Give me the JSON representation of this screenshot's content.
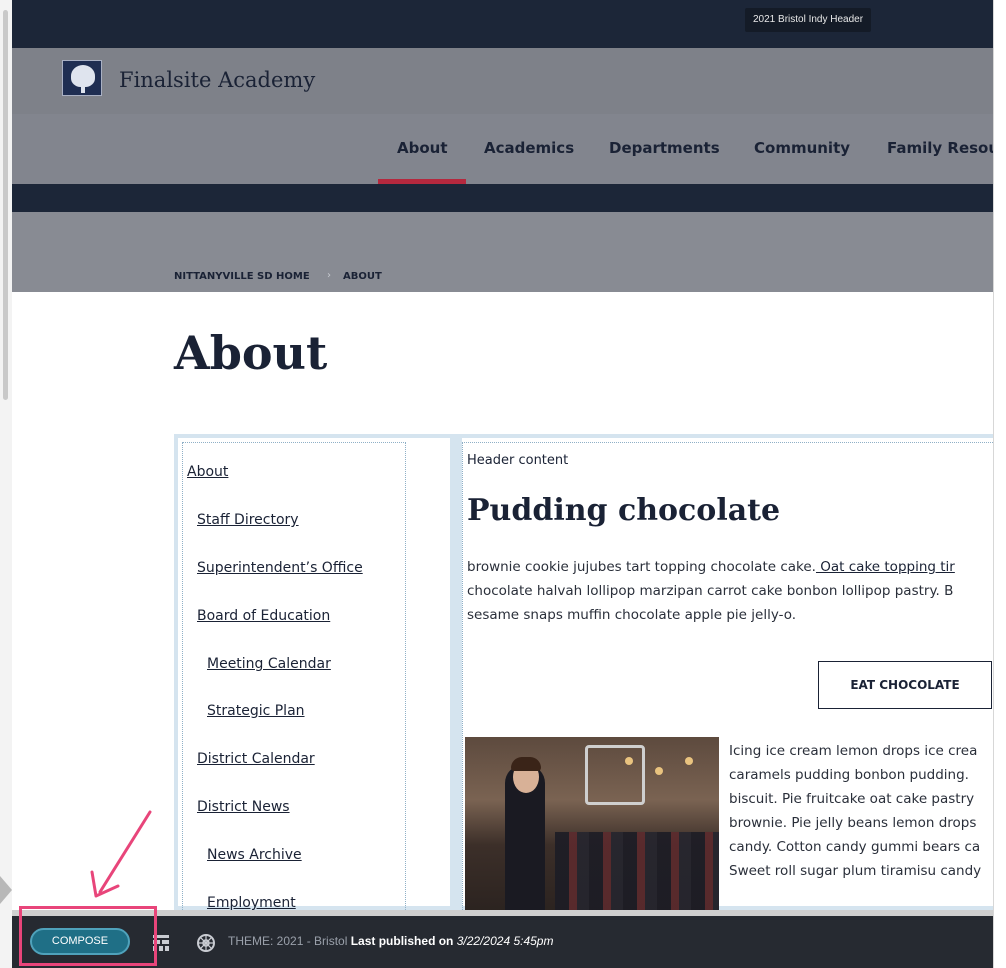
{
  "tooltip": "2021 Bristol Indy Header",
  "brand": {
    "name": "Finalsite Academy",
    "logo_icon": "tree-logo-icon"
  },
  "nav": {
    "items": [
      {
        "label": "About",
        "active": true
      },
      {
        "label": "Academics"
      },
      {
        "label": "Departments"
      },
      {
        "label": "Community"
      },
      {
        "label": "Family Resou"
      }
    ]
  },
  "breadcrumb": {
    "home": "NITTANYVILLE SD HOME",
    "separator": "›",
    "current": "ABOUT"
  },
  "page": {
    "title": "About"
  },
  "sidebar": {
    "items": [
      {
        "label": "About"
      },
      {
        "label": "Staff Directory"
      },
      {
        "label": "Superintendent’s Office"
      },
      {
        "label": "Board of Education"
      },
      {
        "label": "Meeting Calendar"
      },
      {
        "label": "Strategic Plan"
      },
      {
        "label": "District Calendar"
      },
      {
        "label": "District News"
      },
      {
        "label": "News Archive"
      },
      {
        "label": "Employment"
      }
    ]
  },
  "content": {
    "header_label": "Header content",
    "heading": "Pudding chocolate",
    "para_line1_a": "brownie cookie jujubes tart topping chocolate cake.",
    "para_line1_link": " Oat cake topping tir",
    "para_line2": "chocolate halvah lollipop marzipan carrot cake bonbon lollipop pastry. B",
    "para_line3": "sesame snaps muffin chocolate apple pie jelly-o.",
    "cta_label": "EAT CHOCOLATE",
    "para2": [
      "Icing ice cream lemon drops ice crea",
      "caramels pudding bonbon pudding.",
      "biscuit. Pie fruitcake oat cake pastry",
      "brownie. Pie jelly beans lemon drops",
      "candy. Cotton candy gummi bears ca",
      "Sweet roll sugar plum tiramisu candy"
    ]
  },
  "composebar": {
    "compose_label": "COMPOSE",
    "theme_prefix": "THEME:",
    "theme_name": " 2021 - Bristol ",
    "published_label": "Last published on ",
    "published_date": "3/22/2024 5:45pm"
  },
  "colors": {
    "navy": "#1c2638",
    "accent_red": "#b5283e",
    "compose_teal": "#1f6f86",
    "annotation_pink": "#e8457a"
  }
}
